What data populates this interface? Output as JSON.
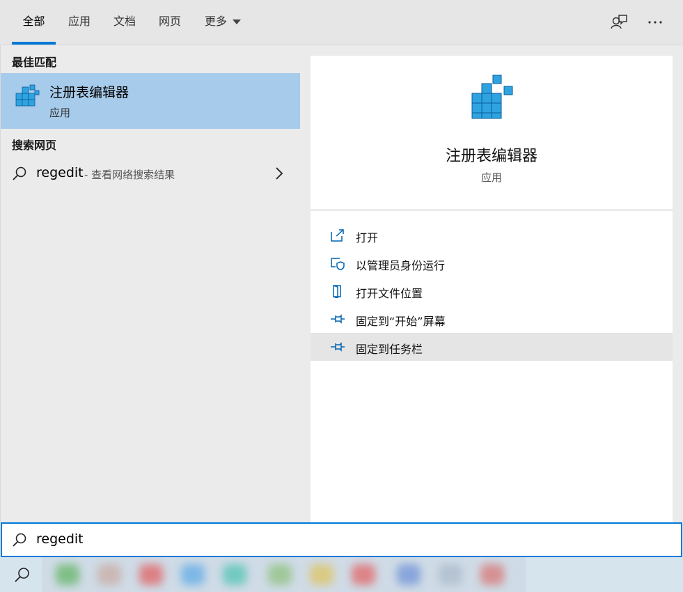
{
  "tabs": [
    {
      "label": "全部",
      "active": true
    },
    {
      "label": "应用",
      "active": false
    },
    {
      "label": "文档",
      "active": false
    },
    {
      "label": "网页",
      "active": false
    },
    {
      "label": "更多",
      "active": false,
      "dropdown": true
    }
  ],
  "toolbar_icons": [
    "feedback-icon",
    "more-options-icon"
  ],
  "left": {
    "best_match_title": "最佳匹配",
    "best_match": {
      "name": "注册表编辑器",
      "type": "应用",
      "icon": "registry-editor-icon"
    },
    "web_title": "搜索网页",
    "web_result": {
      "query": "regedit",
      "hint": "- 查看网络搜索结果"
    }
  },
  "preview": {
    "title": "注册表编辑器",
    "subtitle": "应用",
    "icon": "registry-editor-icon"
  },
  "actions": [
    {
      "label": "打开",
      "icon": "open-icon"
    },
    {
      "label": "以管理员身份运行",
      "icon": "run-as-admin-icon"
    },
    {
      "label": "打开文件位置",
      "icon": "file-location-icon"
    },
    {
      "label": "固定到“开始”屏幕",
      "icon": "pin-icon"
    },
    {
      "label": "固定到任务栏",
      "icon": "pin-icon",
      "highlighted": true
    }
  ],
  "search": {
    "value": "regedit"
  },
  "colors": {
    "accent": "#0078d7",
    "selected": "#a7cbea",
    "hover": "#e5e5e5"
  }
}
